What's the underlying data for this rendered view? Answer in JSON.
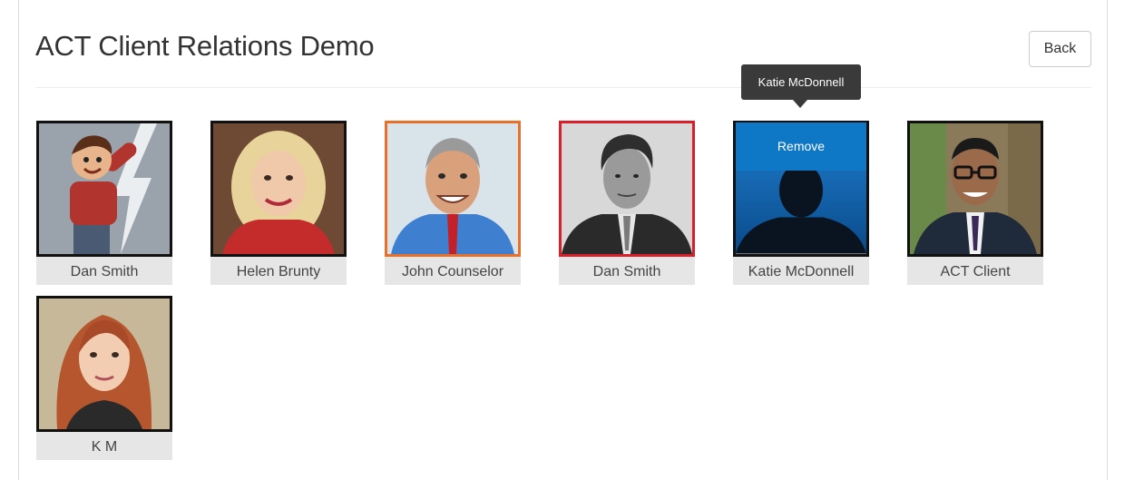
{
  "page": {
    "title": "ACT Client Relations Demo",
    "back_label": "Back"
  },
  "tooltip": {
    "text": "Katie McDonnell"
  },
  "members": [
    {
      "name": "Dan Smith",
      "border_color": "#111111",
      "avatar": "cartoon-avatar"
    },
    {
      "name": "Helen Brunty",
      "border_color": "#111111",
      "avatar": "photo-blonde-woman"
    },
    {
      "name": "John Counselor",
      "border_color": "#e8702a",
      "avatar": "photo-smiling-man"
    },
    {
      "name": "Dan Smith",
      "border_color": "#d81f2a",
      "avatar": "photo-man-bw"
    },
    {
      "name": "Katie McDonnell",
      "border_color": "#111111",
      "avatar": "silhouette-placeholder",
      "overlay_label": "Remove"
    },
    {
      "name": "ACT Client",
      "border_color": "#111111",
      "avatar": "photo-man-glasses"
    },
    {
      "name": "K M",
      "border_color": "#111111",
      "avatar": "photo-red-hair-woman"
    }
  ],
  "colors": {
    "remove_overlay": "#0e78c7",
    "name_bar": "#e6e6e6",
    "tooltip_bg": "#3a3a3a"
  }
}
